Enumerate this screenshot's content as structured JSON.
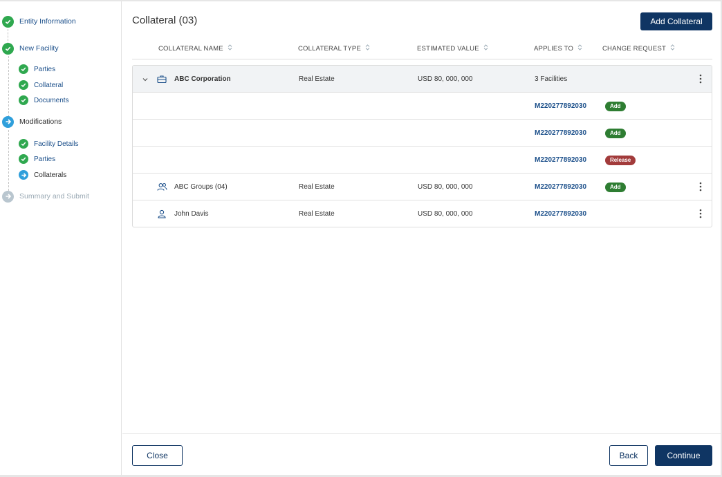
{
  "sidebar": {
    "steps": [
      {
        "label": "Entity Information",
        "status": "complete"
      },
      {
        "label": "New Facility",
        "status": "complete"
      },
      {
        "label": "Parties",
        "status": "complete"
      },
      {
        "label": "Collateral",
        "status": "complete"
      },
      {
        "label": "Documents",
        "status": "complete"
      },
      {
        "label": "Modifications",
        "status": "current"
      },
      {
        "label": "Facility Details",
        "status": "complete"
      },
      {
        "label": "Parties",
        "status": "complete"
      },
      {
        "label": "Collaterals",
        "status": "current"
      },
      {
        "label": "Summary and Submit",
        "status": "pending"
      }
    ]
  },
  "header": {
    "title": "Collateral (03)",
    "add_button": "Add Collateral"
  },
  "table": {
    "columns": [
      "COLLATERAL NAME",
      "COLLATERAL TYPE",
      "ESTIMATED VALUE",
      "APPLIES TO",
      "CHANGE REQUEST"
    ],
    "rows": [
      {
        "name": "ABC Corporation",
        "type": "Real Estate",
        "value": "USD 80, 000, 000",
        "applies": "3 Facilities",
        "change": "",
        "icon": "briefcase-icon"
      },
      {
        "name": "",
        "type": "",
        "value": "",
        "applies": "M220277892030",
        "change": "Add"
      },
      {
        "name": "",
        "type": "",
        "value": "",
        "applies": "M220277892030",
        "change": "Add"
      },
      {
        "name": "",
        "type": "",
        "value": "",
        "applies": "M220277892030",
        "change": "Release"
      },
      {
        "name": "ABC Groups (04)",
        "type": "Real Estate",
        "value": "USD 80, 000, 000",
        "applies": "M220277892030",
        "change": "Add",
        "icon": "users-icon"
      },
      {
        "name": "John Davis",
        "type": "Real Estate",
        "value": "USD 80, 000, 000",
        "applies": "M220277892030",
        "change": "",
        "icon": "user-icon"
      }
    ]
  },
  "footer": {
    "close": "Close",
    "back": "Back",
    "continue": "Continue"
  },
  "colors": {
    "primary": "#0f3563",
    "complete": "#2fa84f",
    "current": "#2f9fdb",
    "pending": "#b9c6cf",
    "badge_add": "#2e7d32",
    "badge_release": "#a23b3b"
  }
}
